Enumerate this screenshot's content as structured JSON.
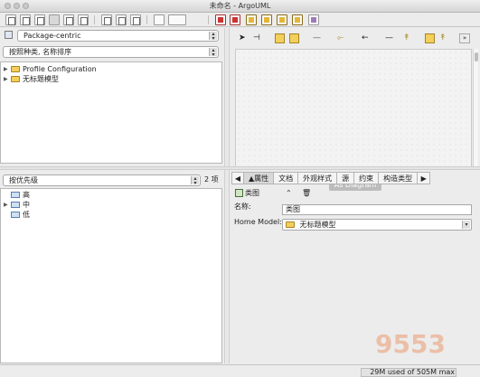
{
  "window": {
    "title": "未命名 - ArgoUML"
  },
  "explorer": {
    "perspective": "Package-centric",
    "sort_order": "按照种类, 名称排序",
    "tree": [
      {
        "label": "Profile Configuration",
        "icon": "folder-icon"
      },
      {
        "label": "无标题模型",
        "icon": "folder-icon"
      }
    ]
  },
  "diagram": {
    "as_diagram_button": "As Diagram"
  },
  "todo": {
    "group_by": "按优先级",
    "count": "2 项",
    "tree": [
      {
        "label": "高",
        "expandable": false
      },
      {
        "label": "中",
        "expandable": true
      },
      {
        "label": "低",
        "expandable": false
      }
    ]
  },
  "details": {
    "tabs": [
      "▲属性",
      "文档",
      "外观样式",
      "源",
      "约束",
      "构造类型"
    ],
    "element_type": "类图",
    "name_label": "名称:",
    "name_value": "类图",
    "home_model_label": "Home Model:",
    "home_model_value": "无标题模型"
  },
  "status": {
    "memory": "29M used of 505M max"
  },
  "watermark": "9553"
}
